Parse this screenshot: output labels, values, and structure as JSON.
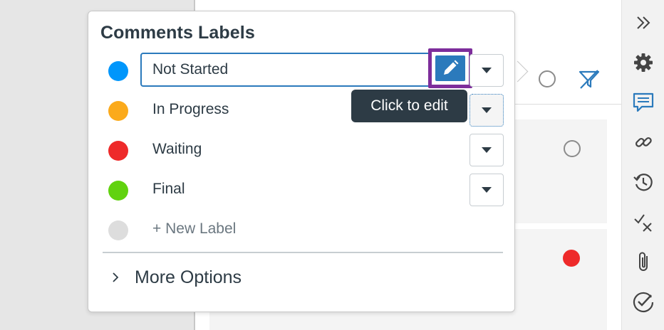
{
  "popover": {
    "title": "Comments Labels",
    "labels": [
      {
        "name": "Not Started",
        "color": "#0096fb",
        "editing": true
      },
      {
        "name": "In Progress",
        "color": "#fbaa1b"
      },
      {
        "name": "Waiting",
        "color": "#ee2a2a"
      },
      {
        "name": "Final",
        "color": "#61d20f"
      }
    ],
    "new_label": {
      "text": "+ New Label",
      "color": "#dddddd"
    },
    "tooltip": "Click to edit",
    "more_options": "More Options"
  },
  "accent_color": "#2b7abc",
  "highlight_color": "#7d2d9b",
  "rail_icons": [
    "expand-icon",
    "gear-icon",
    "comments-icon",
    "link-icon",
    "history-icon",
    "check-x-icon",
    "attachment-icon",
    "check-circle-icon"
  ]
}
